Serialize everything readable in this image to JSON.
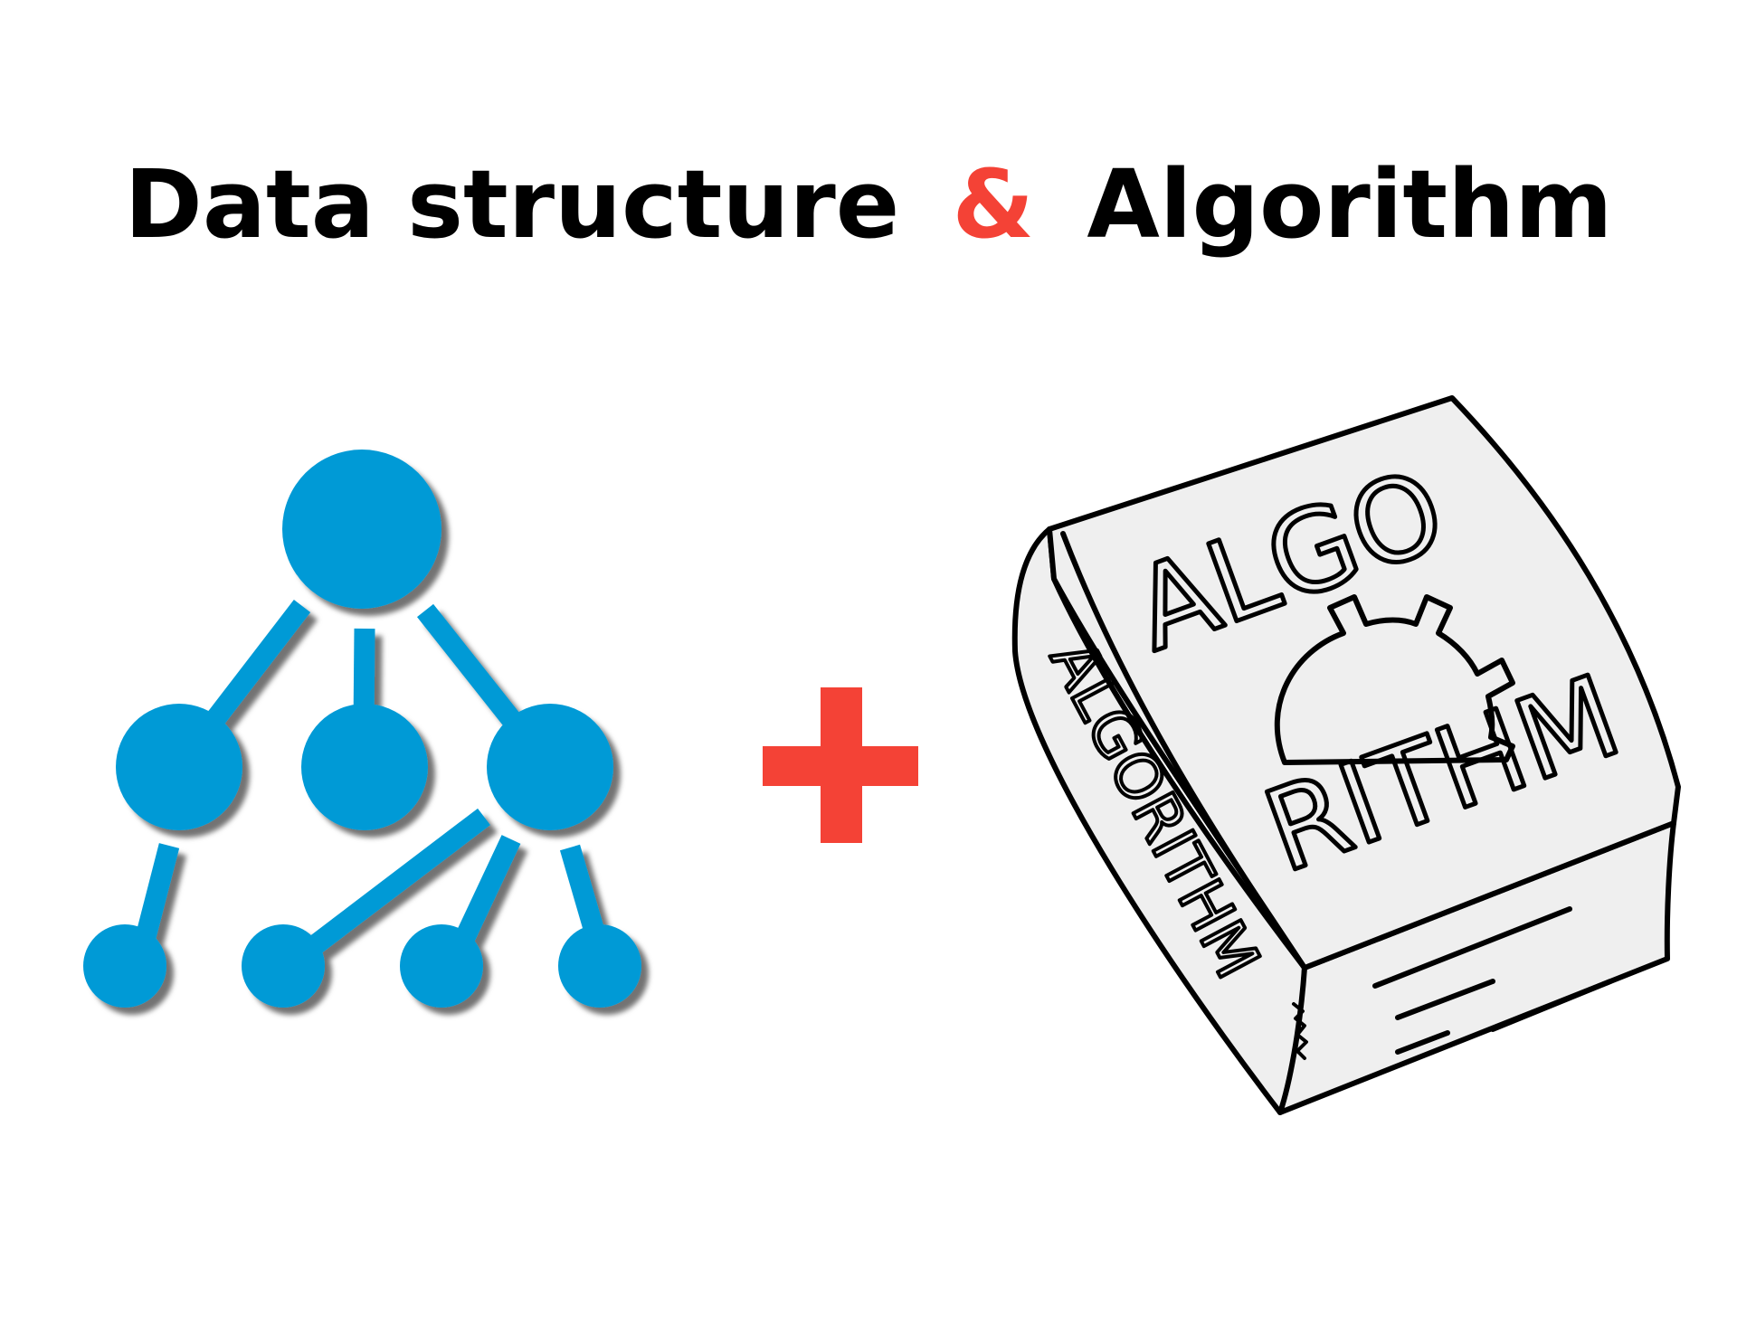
{
  "title": {
    "part1": "Data structure",
    "connector": "&",
    "part2": "Algorithm"
  },
  "book": {
    "cover_top": "ALGO",
    "cover_bottom": "RITHM",
    "spine": "ALGORITHM"
  },
  "colors": {
    "title_text": "#000000",
    "accent": "#f44236",
    "tree": "#049ad6",
    "book_cover": "#efefef",
    "book_outline": "#000000"
  },
  "icons": {
    "tree": "tree-structure-icon",
    "plus": "plus-icon",
    "book": "algorithm-book-icon",
    "gear": "gear-icon"
  }
}
